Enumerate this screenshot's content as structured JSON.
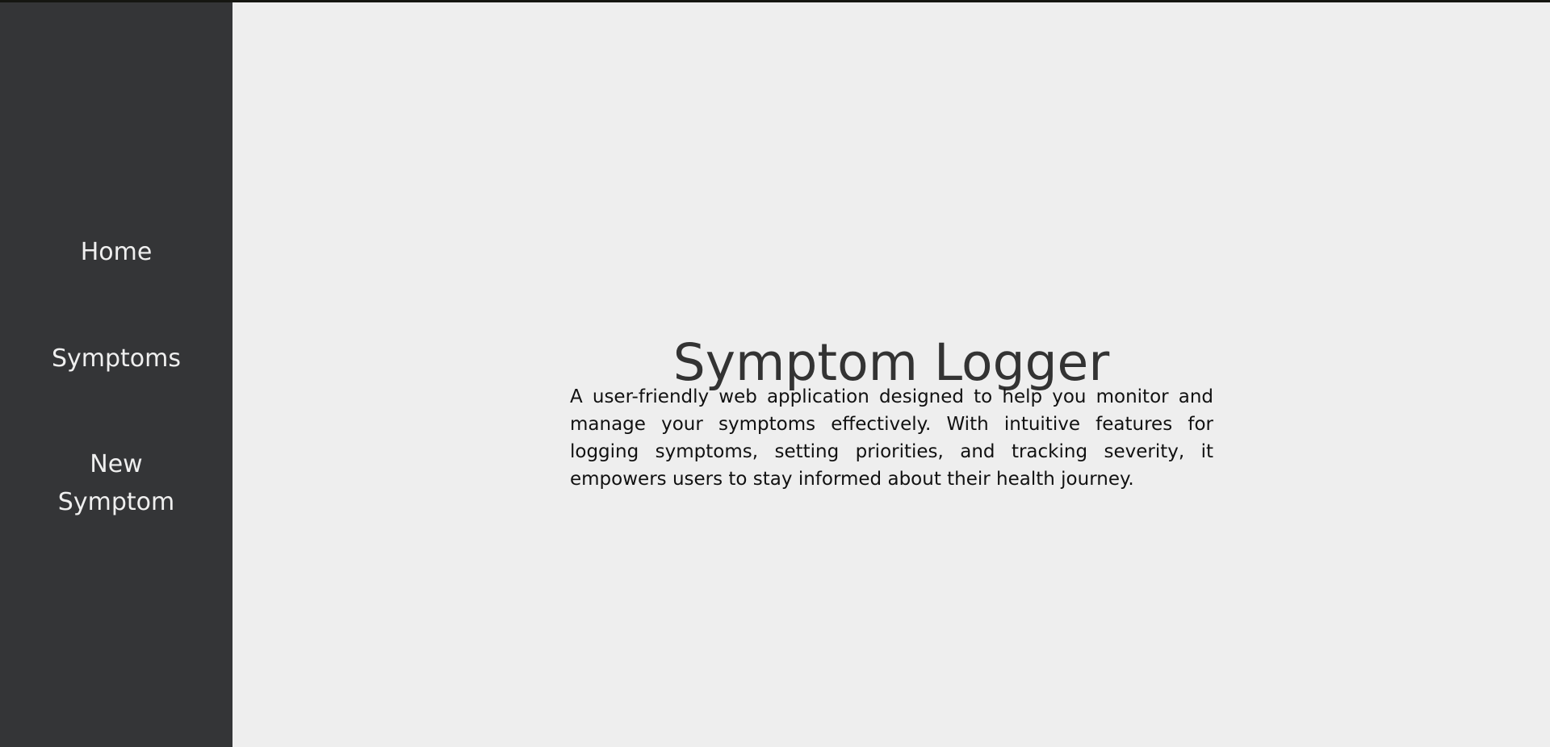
{
  "sidebar": {
    "items": [
      {
        "label": "Home"
      },
      {
        "label": "Symptoms"
      },
      {
        "label": "New Symptom"
      }
    ]
  },
  "main": {
    "title": "Symptom Logger",
    "description": "A user-friendly web application designed to help you monitor and manage your symptoms effectively. With intuitive features for logging symptoms, setting priorities, and tracking severity, it empowers users to stay informed about their health journey."
  },
  "colors": {
    "sidebar_bg": "#343537",
    "main_bg": "#eeeeee",
    "nav_text": "#efefef",
    "title_text": "#333333"
  }
}
